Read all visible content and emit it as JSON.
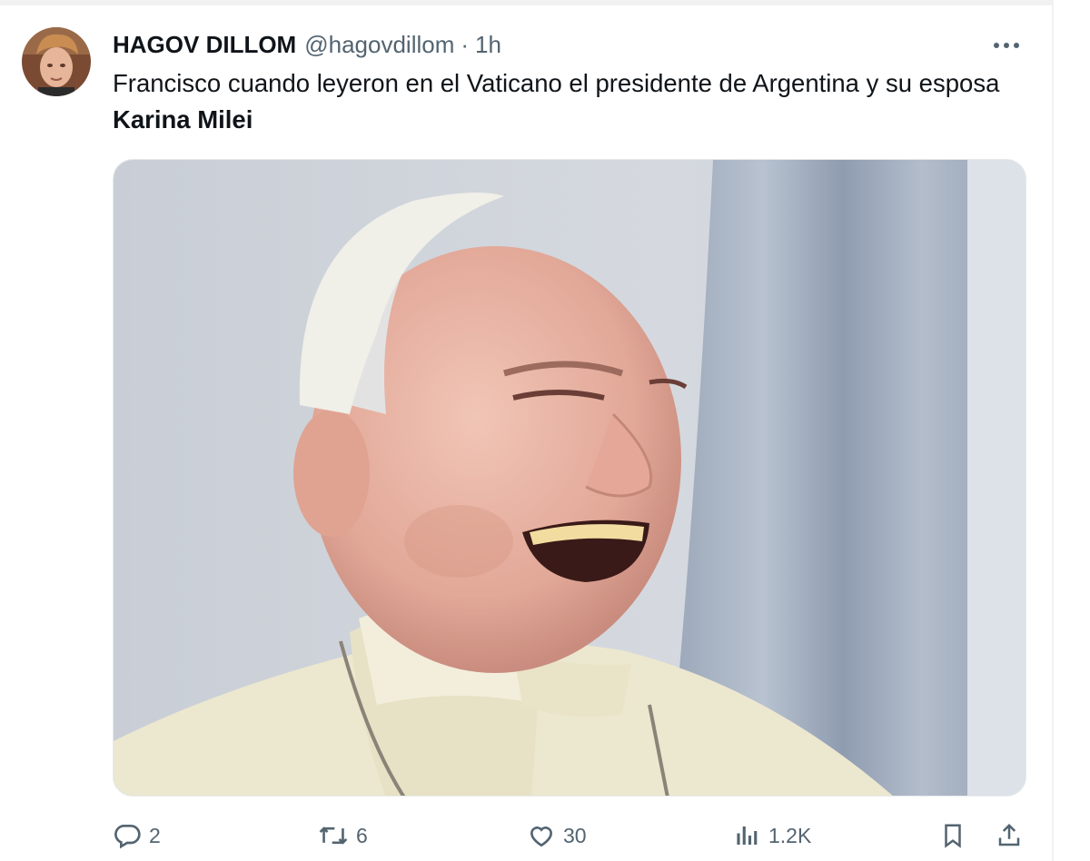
{
  "tweet": {
    "display_name": "HAGOV DILLOM",
    "handle": "@hagovdillom",
    "separator": "·",
    "time": "1h",
    "text_plain": "Francisco cuando leyeron en el Vaticano el presidente de Argentina y su esposa ",
    "text_bold": "Karina Milei",
    "media_icon": "photo-laughing-man-white-cap"
  },
  "actions": {
    "reply": {
      "icon": "reply-icon",
      "count": "2"
    },
    "retweet": {
      "icon": "retweet-icon",
      "count": "6"
    },
    "like": {
      "icon": "heart-icon",
      "count": "30"
    },
    "views": {
      "icon": "views-chart-icon",
      "count": "1.2K"
    },
    "bookmark": {
      "icon": "bookmark-icon"
    },
    "share": {
      "icon": "share-icon"
    }
  },
  "colors": {
    "text": "#0f1419",
    "muted": "#536471",
    "border": "#eff3f4"
  }
}
